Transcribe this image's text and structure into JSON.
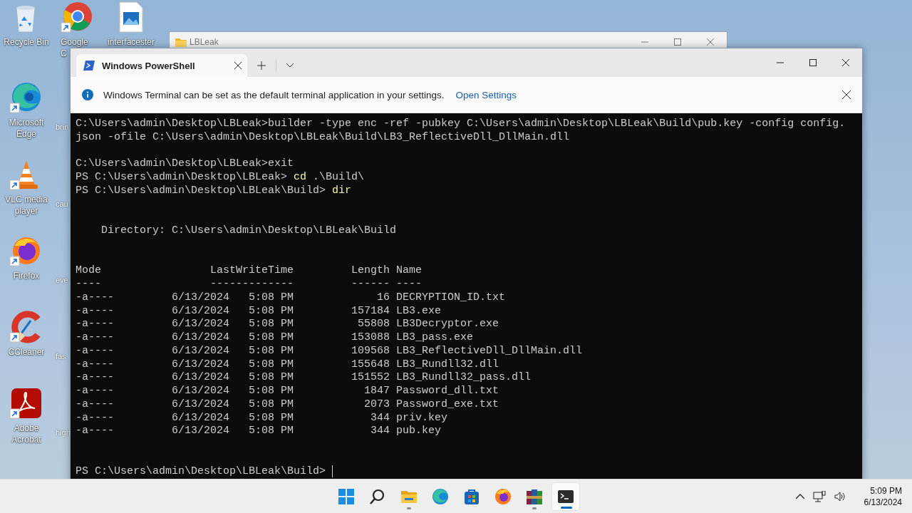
{
  "desktop_icons": [
    {
      "kind": "recycle",
      "label": "Recycle Bin"
    },
    {
      "kind": "chrome",
      "label": "Google C"
    },
    {
      "kind": "image",
      "label": "interfacester"
    },
    {
      "kind": "edge",
      "label": "Microsoft Edge"
    },
    {
      "kind": "partial",
      "label": "brin"
    },
    {
      "kind": "vlc",
      "label": "VLC media player"
    },
    {
      "kind": "partial",
      "label": "cau"
    },
    {
      "kind": "firefox",
      "label": "Firefox"
    },
    {
      "kind": "partial",
      "label": "eve"
    },
    {
      "kind": "ccleaner",
      "label": "CCleaner"
    },
    {
      "kind": "partial",
      "label": "fas"
    },
    {
      "kind": "acrobat",
      "label": "Adobe Acrobat"
    },
    {
      "kind": "partial",
      "label": "high"
    }
  ],
  "explorer_window": {
    "title": "LBLeak"
  },
  "terminal": {
    "tabs": [
      {
        "title": "Windows PowerShell",
        "selected": true
      }
    ],
    "notice": {
      "text": "Windows Terminal can be set as the default terminal application in your settings.",
      "link": "Open Settings"
    },
    "lines": [
      {
        "kind": "text",
        "text": "C:\\Users\\admin\\Desktop\\LBLeak>builder -type enc -ref -pubkey C:\\Users\\admin\\Desktop\\LBLeak\\Build\\pub.key -config config."
      },
      {
        "kind": "text",
        "text": "json -ofile C:\\Users\\admin\\Desktop\\LBLeak\\Build\\LB3_ReflectiveDll_DllMain.dll"
      },
      {
        "kind": "blank"
      },
      {
        "kind": "text",
        "text": "C:\\Users\\admin\\Desktop\\LBLeak>exit"
      },
      {
        "kind": "prompt",
        "prompt": "PS C:\\Users\\admin\\Desktop\\LBLeak>",
        "command": "cd",
        "args": ".\\Build\\"
      },
      {
        "kind": "prompt",
        "prompt": "PS C:\\Users\\admin\\Desktop\\LBLeak\\Build>",
        "command": "dir"
      },
      {
        "kind": "blank"
      },
      {
        "kind": "blank"
      },
      {
        "kind": "directory",
        "text": "Directory: C:\\Users\\admin\\Desktop\\LBLeak\\Build"
      },
      {
        "kind": "blank"
      },
      {
        "kind": "blank"
      },
      {
        "kind": "header",
        "cells": [
          "Mode",
          "LastWriteTime",
          "Length",
          "Name"
        ]
      },
      {
        "kind": "header",
        "cells": [
          "----",
          "-------------",
          "------",
          "----"
        ]
      },
      {
        "kind": "file",
        "mode": "-a----",
        "date": "6/13/2024",
        "time": "5:08 PM",
        "length": "16",
        "name": "DECRYPTION_ID.txt"
      },
      {
        "kind": "file",
        "mode": "-a----",
        "date": "6/13/2024",
        "time": "5:08 PM",
        "length": "157184",
        "name": "LB3.exe"
      },
      {
        "kind": "file",
        "mode": "-a----",
        "date": "6/13/2024",
        "time": "5:08 PM",
        "length": "55808",
        "name": "LB3Decryptor.exe"
      },
      {
        "kind": "file",
        "mode": "-a----",
        "date": "6/13/2024",
        "time": "5:08 PM",
        "length": "153088",
        "name": "LB3_pass.exe"
      },
      {
        "kind": "file",
        "mode": "-a----",
        "date": "6/13/2024",
        "time": "5:08 PM",
        "length": "109568",
        "name": "LB3_ReflectiveDll_DllMain.dll"
      },
      {
        "kind": "file",
        "mode": "-a----",
        "date": "6/13/2024",
        "time": "5:08 PM",
        "length": "155648",
        "name": "LB3_Rundll32.dll"
      },
      {
        "kind": "file",
        "mode": "-a----",
        "date": "6/13/2024",
        "time": "5:08 PM",
        "length": "151552",
        "name": "LB3_Rundll32_pass.dll"
      },
      {
        "kind": "file",
        "mode": "-a----",
        "date": "6/13/2024",
        "time": "5:08 PM",
        "length": "1847",
        "name": "Password_dll.txt"
      },
      {
        "kind": "file",
        "mode": "-a----",
        "date": "6/13/2024",
        "time": "5:08 PM",
        "length": "2073",
        "name": "Password_exe.txt"
      },
      {
        "kind": "file",
        "mode": "-a----",
        "date": "6/13/2024",
        "time": "5:08 PM",
        "length": "344",
        "name": "priv.key"
      },
      {
        "kind": "file",
        "mode": "-a----",
        "date": "6/13/2024",
        "time": "5:08 PM",
        "length": "344",
        "name": "pub.key"
      },
      {
        "kind": "blank"
      },
      {
        "kind": "blank"
      },
      {
        "kind": "prompt",
        "prompt": "PS C:\\Users\\admin\\Desktop\\LBLeak\\Build>",
        "cursor": true
      }
    ]
  },
  "taskbar": {
    "items": [
      {
        "kind": "start",
        "running": false,
        "selected": false
      },
      {
        "kind": "search",
        "running": false,
        "selected": false
      },
      {
        "kind": "explorer",
        "running": true,
        "selected": false
      },
      {
        "kind": "edge",
        "running": false,
        "selected": false
      },
      {
        "kind": "store",
        "running": false,
        "selected": false
      },
      {
        "kind": "firefox",
        "running": false,
        "selected": false
      },
      {
        "kind": "winrar",
        "running": true,
        "selected": false
      },
      {
        "kind": "terminal",
        "running": true,
        "selected": true
      }
    ],
    "clock": {
      "time": "5:09 PM",
      "date": "6/13/2024"
    }
  }
}
